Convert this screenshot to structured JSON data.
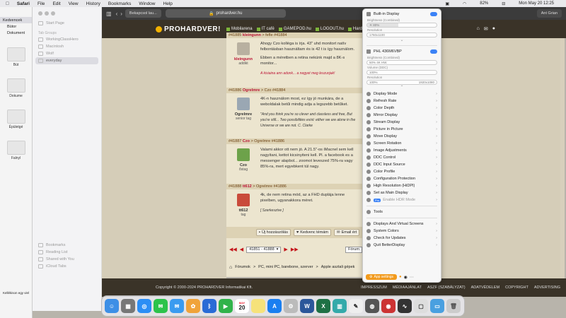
{
  "menubar": {
    "app": "Safari",
    "items": [
      "File",
      "Edit",
      "View",
      "History",
      "Bookmarks",
      "Window",
      "Help"
    ],
    "battery": "82%",
    "clock": "Mon May 20  12:25"
  },
  "finder": {
    "rows": [
      "Kedvencek",
      "Bütor",
      "Dokument"
    ],
    "labels": [
      "Bút",
      "Dokume",
      "Épületgé",
      "Falnyl"
    ],
    "bottom": "Kellékison egy viel"
  },
  "sidebar": {
    "start_page": "Start Page",
    "groups_header": "Tab Groups",
    "groups": [
      "WorkingClassHero",
      "Macintosh",
      "Wolf",
      "everyday"
    ],
    "footer": [
      "Bookmarks",
      "Reading List",
      "Shared with You",
      "iCloud Tabs"
    ]
  },
  "browser": {
    "tab1": "Bekapcsol lau...",
    "url": "prohardver.hu",
    "tab_right": "Ant Grian"
  },
  "site": {
    "logo": "PROHARDVER!",
    "nav": [
      "Mobilarena",
      "IT café",
      "GAMEPOD.hu",
      "LOGOUT.hu",
      "HardverApr"
    ],
    "posts": [
      {
        "head_id": "#41885",
        "head_user": "kleingunn",
        "head_sep": ">",
        "head_to": "fefle #41884",
        "user": "kleingunn",
        "title": "addikt",
        "text": "Ahogy Czo kolléga is írja. 43\" uhd monitort natív felbontásban használtam és is 42 t is így használom.",
        "text2": "Ebben a méretben a retina nekünk majd a 8K-s monitor...",
        "quote": "A kisiaina ann adonk... a negyet meg leszunjak!"
      },
      {
        "head_id": "#41886",
        "head_user": "Ogrelmre",
        "head_sep": ">",
        "head_to": "Czo #41884",
        "user": "Ogrelmre",
        "title": "senior tag",
        "text": "4K-n használom most, ez így jó munkára, de a weboldalak betűi mindig adja a legszebb betűket.",
        "text2": "",
        "quote": "\"And you think you're so clever and classless and free, But you're still... Two possibilities exist: either we are alone in the Universe or we are not. C. Clarke"
      },
      {
        "head_id": "#41887",
        "head_user": "Czo",
        "head_sep": ">",
        "head_to": "Ogrelmre #41886",
        "user": "Czo",
        "title": "őstag",
        "text": "Valami akkor ott nem jó. A 21.5\"-os iMacnel sem kell nagyítani, kettot kicsinyiteni kell. Pl. a facebook es a messenger alapbol... zoomot leveszed 75%-ra vagy 85%-ra, mert egyebkent túl nagy.",
        "text2": "",
        "quote": ""
      },
      {
        "head_id": "#41888",
        "head_user": "tt612",
        "head_sep": ">",
        "head_to": "Ogrelmre #41886",
        "user": "tt612",
        "title": "tag",
        "text": "4k, de nem retina mód, az a FHD duplája lenne pixelben, ugyanakkora méret.",
        "text2": "",
        "quote": "[ Szerkesztve ]"
      }
    ],
    "buttons": [
      "Új hozzászólás",
      "Kedvenc témám",
      "Email ért"
    ],
    "pager_range": "41851 - 41888",
    "pager_right": "Fórum",
    "breadcrumb": [
      "Fórumok",
      ">",
      "PC, mini PC, barebone, szerver",
      ">",
      "Apple asztali gépek"
    ],
    "footer_copy": "Copyright © 2000-2024 PROHARDVER Informatikai Kft.",
    "footer_links": [
      "IMPRESSZUM",
      "MÉDIAAJÁNLAT",
      "ASZF (SZABÁLYZAT)",
      "ADATVÉDELEM",
      "COPYRIGHT",
      "ADVERTISING"
    ]
  },
  "panel": {
    "builtin": "Built-in Display",
    "brightness_label": "Brightness (Combined)",
    "brightness_value": "80%",
    "resolution_label": "Resolution",
    "resolution_value": "1760x1100",
    "brightness_fraction": 0.45,
    "phl": "PHL 436M6VBP",
    "phl_brightness_label": "Brightness (Combined)",
    "phl_brightness_value": "50% 4K HW",
    "volume_label": "Volume (DDC)",
    "volume_value": "100%",
    "phl_res_label": "Resolution",
    "phl_res_value": "100%",
    "phl_res_right": "1920x1080",
    "menu": [
      "Display Mode",
      "Refresh Rate",
      "Color Depth",
      "Mirror Display",
      "Stream Display",
      "Picture in Picture",
      "Move Display",
      "Screen Rotation",
      "Image Adjustments",
      "DDC Control",
      "DDC Input Source",
      "Color Profile",
      "Configuration Protection",
      "High Resolution (HiDPI)",
      "Set as Main Display",
      "Enable HDR Mode"
    ],
    "hdr_badge": "Pro",
    "tools": "Tools",
    "menu2": [
      "Displays And Virtual Screens",
      "System Colors",
      "Check for Updates",
      "Quit BetterDisplay"
    ],
    "app_settings": "App settings"
  },
  "dock": {
    "calendar_month": "MAY",
    "calendar_day": "20"
  }
}
